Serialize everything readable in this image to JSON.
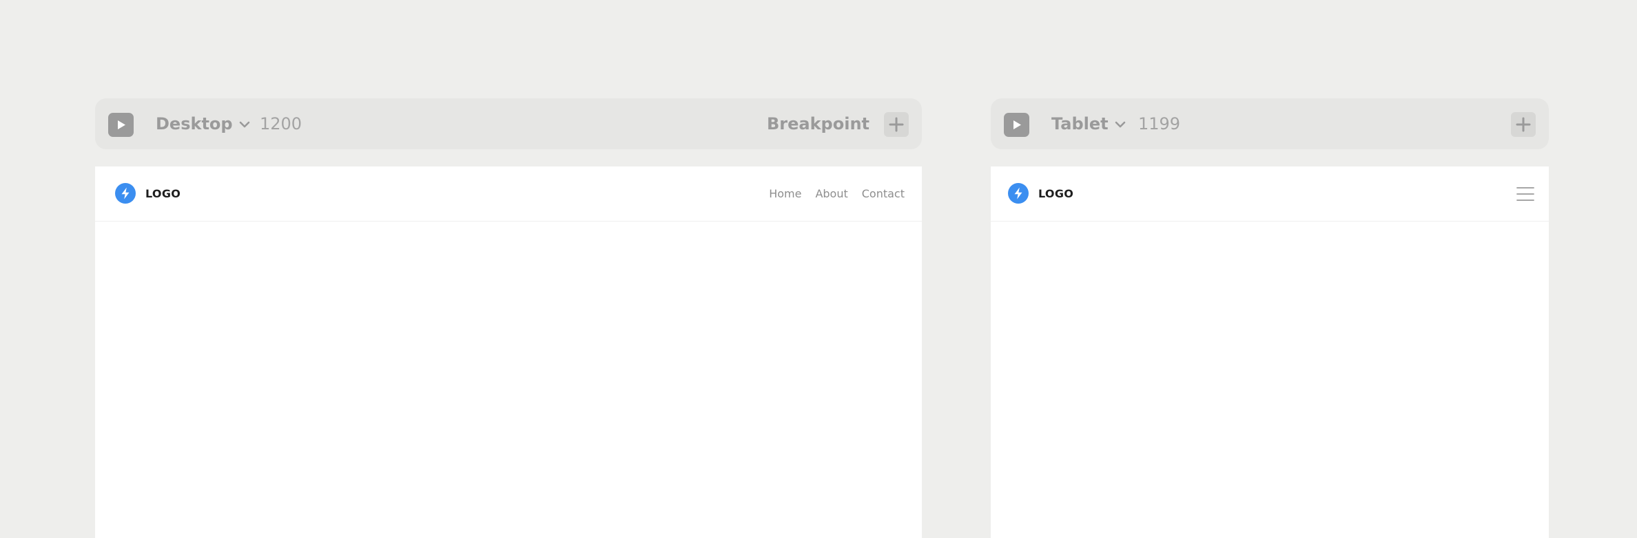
{
  "frames": [
    {
      "id": "desktop",
      "toolbar": {
        "play_icon": "play-icon",
        "device_label": "Desktop",
        "device_dropdown_icon": "chevron-down-icon",
        "width": "1200",
        "breakpoint_label": "Breakpoint",
        "add_icon": "plus-icon"
      },
      "site": {
        "logo_icon": "lightning-bolt-icon",
        "logo_text": "LOGO",
        "nav": [
          "Home",
          "About",
          "Contact"
        ]
      }
    },
    {
      "id": "tablet",
      "toolbar": {
        "play_icon": "play-icon",
        "device_label": "Tablet",
        "device_dropdown_icon": "chevron-down-icon",
        "width": "1199",
        "add_icon": "plus-icon"
      },
      "site": {
        "logo_icon": "lightning-bolt-icon",
        "logo_text": "LOGO",
        "menu_icon": "hamburger-menu-icon"
      }
    }
  ],
  "colors": {
    "page_background": "#eeeeec",
    "toolbar_background": "#e6e6e4",
    "toolbar_text": "#9a9a9a",
    "logo_accent": "#3b8ef0",
    "canvas_background": "#ffffff",
    "nav_text": "#8e8e8e"
  }
}
